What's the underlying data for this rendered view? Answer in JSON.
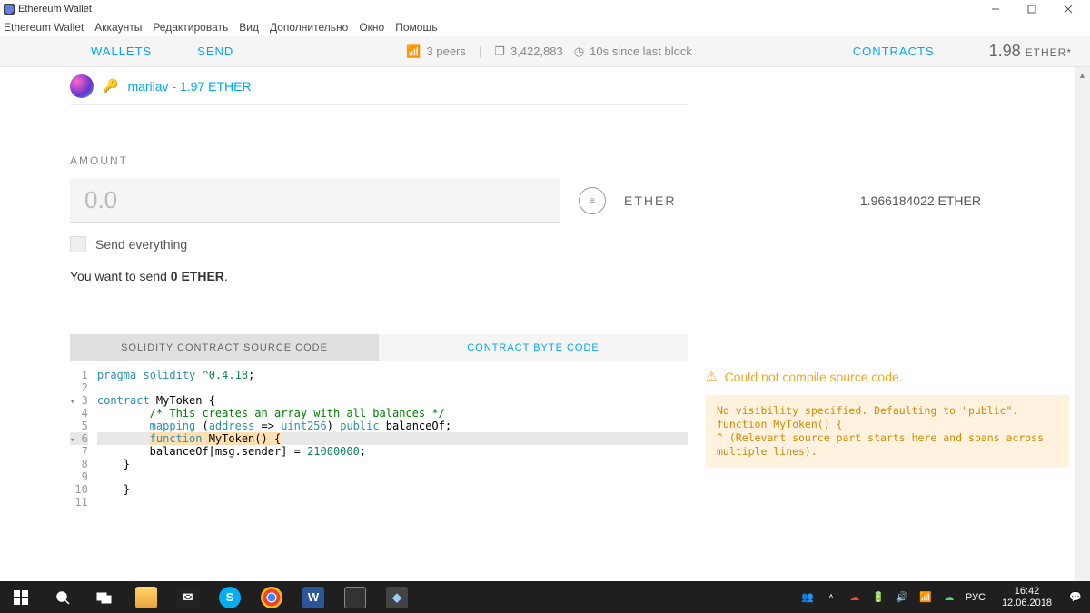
{
  "titlebar": {
    "title": "Ethereum Wallet"
  },
  "menubar": {
    "items": [
      "Ethereum Wallet",
      "Аккаунты",
      "Редактировать",
      "Вид",
      "Дополнительно",
      "Окно",
      "Помощь"
    ]
  },
  "topnav": {
    "wallets": "WALLETS",
    "send": "SEND",
    "peers": "3 peers",
    "block_number": "3,422,883",
    "since_block": "10s since last block",
    "contracts": "CONTRACTS",
    "balance_value": "1.98",
    "balance_unit": "ETHER*"
  },
  "account": {
    "name": "mariiav - 1.97 ETHER"
  },
  "amount": {
    "label": "AMOUNT",
    "value": "0.0",
    "currency": "ETHER",
    "available": "1.966184022 ETHER",
    "send_everything": "Send everything",
    "summary_prefix": "You want to send ",
    "summary_bold": "0 ETHER",
    "summary_suffix": "."
  },
  "tabs": {
    "source": "SOLIDITY CONTRACT SOURCE CODE",
    "bytecode": "CONTRACT BYTE CODE"
  },
  "code": {
    "lines": [
      "pragma solidity ^0.4.18;",
      "",
      "contract MyToken {",
      "        /* This creates an array with all balances */",
      "        mapping (address => uint256) public balanceOf;",
      "        function MyToken() {",
      "        balanceOf[msg.sender] = 21000000;",
      "    }",
      "",
      "    }",
      ""
    ]
  },
  "error": {
    "title": "Could not compile source code.",
    "body_l1": "No visibility specified. Defaulting to \"public\".",
    "body_l2": "        function MyToken() {",
    "body_l3": "        ^ (Relevant source part starts here and spans across multiple lines)."
  },
  "taskbar": {
    "lang": "РУС",
    "time": "16:42",
    "date": "12.06.2018"
  }
}
